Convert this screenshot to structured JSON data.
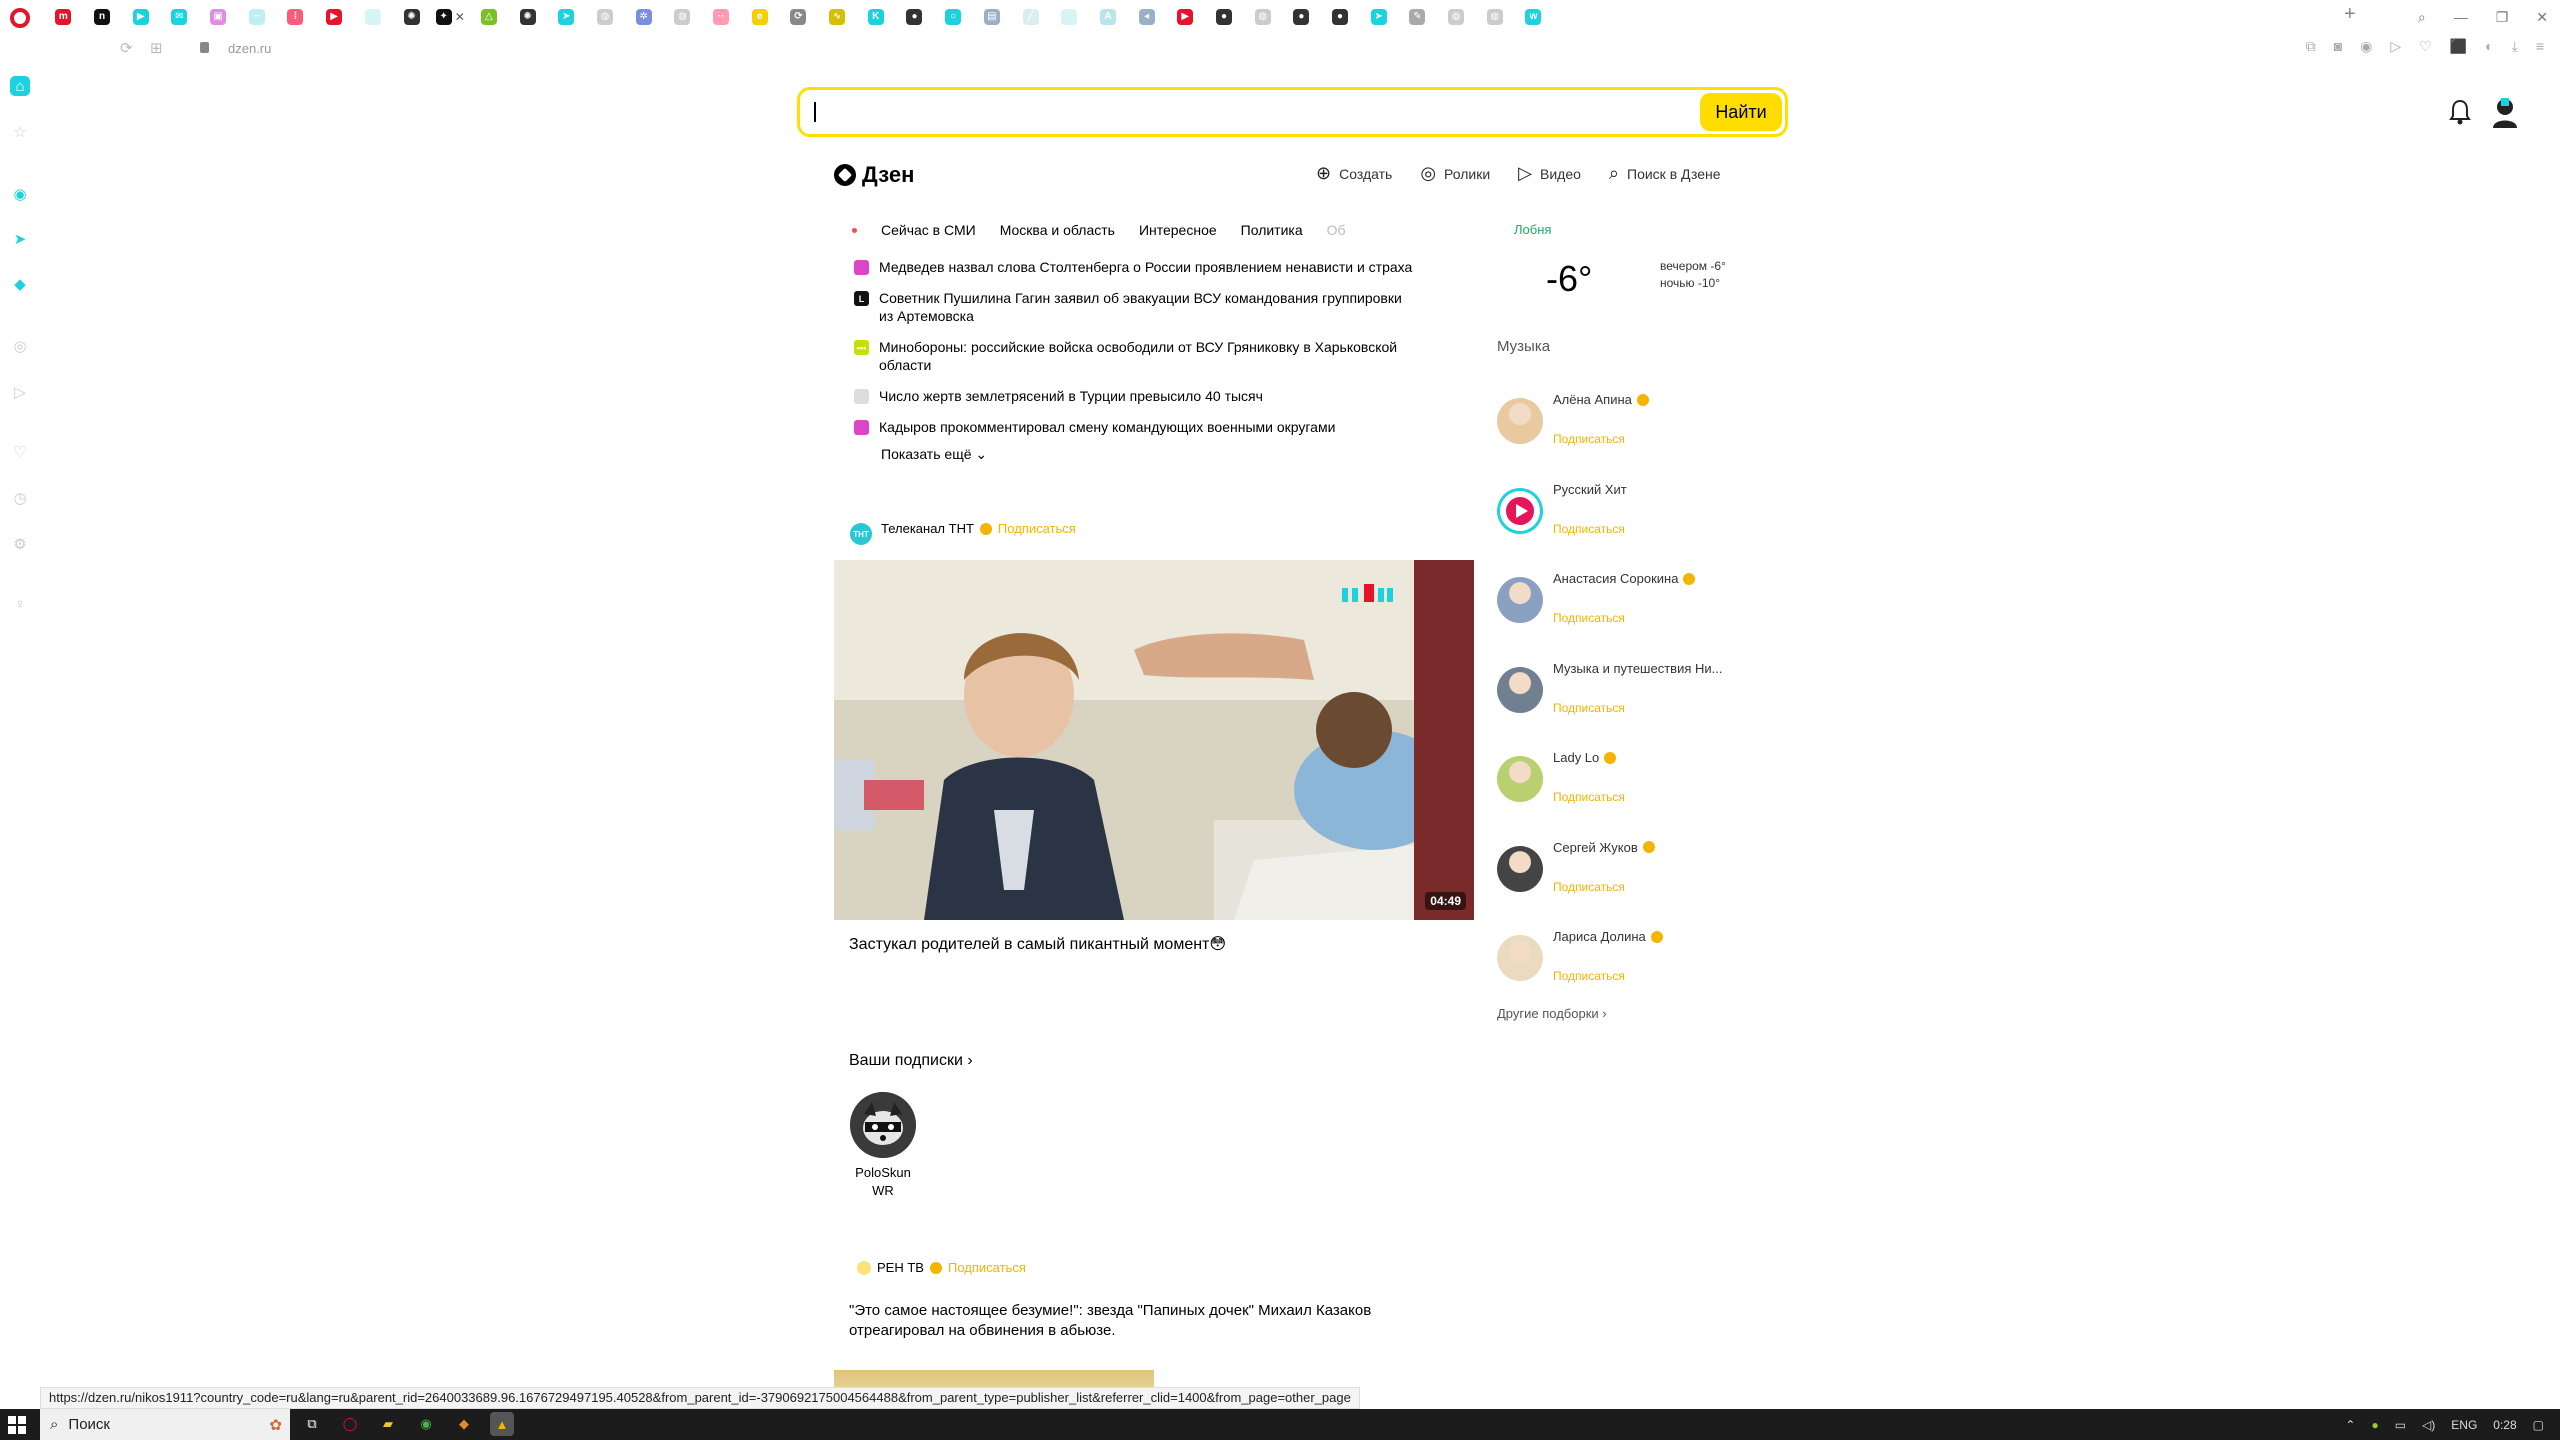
{
  "browser": {
    "url": "dzen.ru",
    "tabs": [
      {
        "icon": "gmail-icon",
        "color": "#e5142b",
        "glyph": "m"
      },
      {
        "icon": "notion-icon",
        "color": "#111111",
        "glyph": "n"
      },
      {
        "icon": "tab-audio-icon",
        "color": "#1dd2dc",
        "glyph": "▶"
      },
      {
        "icon": "mail-icon",
        "color": "#1dd2dc",
        "glyph": "✉"
      },
      {
        "icon": "app-icon",
        "color": "#e08de0",
        "glyph": "▣"
      },
      {
        "icon": "wave-icon",
        "color": "#bfeff3",
        "glyph": "~"
      },
      {
        "icon": "dots-icon",
        "color": "#ff5a7a",
        "glyph": "⁞"
      },
      {
        "icon": "youtube-icon",
        "color": "#e5142b",
        "glyph": "▶"
      },
      {
        "icon": "blank-page-icon",
        "color": "#d7f4f6",
        "glyph": ""
      },
      {
        "icon": "chatgpt-icon",
        "color": "#333333",
        "glyph": "✺"
      },
      {
        "icon": "dzen-icon",
        "color": "#111111",
        "glyph": "✦"
      },
      {
        "icon": "drive-icon",
        "color": "#7bbf2a",
        "glyph": "△"
      },
      {
        "icon": "chatgpt-icon",
        "color": "#333333",
        "glyph": "✺"
      },
      {
        "icon": "telegram-icon",
        "color": "#1dd2dc",
        "glyph": "➤"
      },
      {
        "icon": "globe-icon",
        "color": "#cccccc",
        "glyph": "◍"
      },
      {
        "icon": "puzzle-icon",
        "color": "#7a8fe0",
        "glyph": "✲"
      },
      {
        "icon": "globe-icon",
        "color": "#cccccc",
        "glyph": "◍"
      },
      {
        "icon": "dots-icon",
        "color": "#ff9ab0",
        "glyph": "··"
      },
      {
        "icon": "e-icon",
        "color": "#f5d000",
        "glyph": "e"
      },
      {
        "icon": "sync-icon",
        "color": "#888888",
        "glyph": "⟳"
      },
      {
        "icon": "chart-icon",
        "color": "#d4c000",
        "glyph": "∿"
      },
      {
        "icon": "kinopoisk-icon",
        "color": "#1dd2dc",
        "glyph": "K"
      },
      {
        "icon": "github-icon",
        "color": "#333333",
        "glyph": "●"
      },
      {
        "icon": "circle-icon",
        "color": "#1dd2dc",
        "glyph": "○"
      },
      {
        "icon": "image-icon",
        "color": "#9ab0c8",
        "glyph": "▤"
      },
      {
        "icon": "feather-icon",
        "color": "#d8eef0",
        "glyph": "╱"
      },
      {
        "icon": "page-icon",
        "color": "#d7f4f6",
        "glyph": ""
      },
      {
        "icon": "ai-icon",
        "color": "#b8e4ea",
        "glyph": "A"
      },
      {
        "icon": "arrow-icon",
        "color": "#9ab0c8",
        "glyph": "◂"
      },
      {
        "icon": "youtube-icon",
        "color": "#e5142b",
        "glyph": "▶"
      },
      {
        "icon": "github-icon",
        "color": "#333333",
        "glyph": "●"
      },
      {
        "icon": "globe-icon",
        "color": "#cccccc",
        "glyph": "◍"
      },
      {
        "icon": "github-icon",
        "color": "#333333",
        "glyph": "●"
      },
      {
        "icon": "github-icon",
        "color": "#333333",
        "glyph": "●"
      },
      {
        "icon": "telegram-icon",
        "color": "#1dd2dc",
        "glyph": "➤"
      },
      {
        "icon": "pen-icon",
        "color": "#aaaaaa",
        "glyph": "✎"
      },
      {
        "icon": "globe-icon",
        "color": "#cccccc",
        "glyph": "◍"
      },
      {
        "icon": "globe-icon",
        "color": "#cccccc",
        "glyph": "◍"
      },
      {
        "icon": "w-icon",
        "color": "#1dd2dc",
        "glyph": "w"
      }
    ]
  },
  "search": {
    "placeholder": "",
    "button_label": "Найти"
  },
  "header": {
    "logo_text": "Дзен",
    "nav": [
      {
        "icon": "create-icon",
        "glyph": "⊕",
        "label": "Создать"
      },
      {
        "icon": "shorts-icon",
        "glyph": "◎",
        "label": "Ролики"
      },
      {
        "icon": "video-play-icon",
        "glyph": "▷",
        "label": "Видео"
      },
      {
        "icon": "search-icon",
        "glyph": "⌕",
        "label": "Поиск в Дзене"
      }
    ]
  },
  "news": {
    "tabs": [
      "Сейчас в СМИ",
      "Москва и область",
      "Интересное",
      "Политика",
      "Об"
    ],
    "items": [
      {
        "icon_color": "#d946c8",
        "icon_glyph": "",
        "text": "Медведев назвал слова Столтенберга о России проявлением ненависти и страха"
      },
      {
        "icon_color": "#111111",
        "icon_glyph": "L",
        "text": "Советник Пушилина Гагин заявил об эвакуации ВСУ командования группировки из Артемовска"
      },
      {
        "icon_color": "#c8e000",
        "icon_glyph": "•••",
        "text": "Минобороны: российские войска освободили от ВСУ Гряниковку в Харьковской области"
      },
      {
        "icon_color": "#dddddd",
        "icon_glyph": "",
        "text": "Число жертв землетрясений в Турции превысило 40 тысяч"
      },
      {
        "icon_color": "#d946c8",
        "icon_glyph": "",
        "text": "Кадыров прокомментировал смену командующих военными округами"
      }
    ],
    "show_more": "Показать ещё"
  },
  "post1": {
    "channel": "Телеканал ТНТ",
    "avatar_text": "ТНТ",
    "subscribe": "Подписаться",
    "duration": "04:49",
    "title": "Застукал родителей в самый пикантный момент😳"
  },
  "subscriptions": {
    "header": "Ваши подписки",
    "items": [
      {
        "name": "PoloSkun WR"
      }
    ]
  },
  "post2": {
    "channel": "РЕН ТВ",
    "subscribe": "Подписаться",
    "title": "\"Это самое настоящее безумие!\": звезда \"Папиных дочек\" Михаил Казаков отреагировал на обвинения в абьюзе."
  },
  "weather": {
    "city": "Лобня",
    "temp": "-6°",
    "evening": "вечером -6°",
    "night": "ночью -10°"
  },
  "music": {
    "title": "Музыка",
    "artists": [
      {
        "name": "Алёна Апина",
        "verified": true,
        "avatar": "#e8c9a0"
      },
      {
        "name": "Русский Хит",
        "verified": false,
        "avatar": "#1dd2dc"
      },
      {
        "name": "Анастасия Сорокина",
        "verified": true,
        "avatar": "#8aa0c0"
      },
      {
        "name": "Музыка и путешествия Ни...",
        "verified": false,
        "avatar": "#708090"
      },
      {
        "name": "Lady Lo",
        "verified": true,
        "avatar": "#b8d070"
      },
      {
        "name": "Сергей Жуков",
        "verified": true,
        "avatar": "#444444"
      },
      {
        "name": "Лариса Долина",
        "verified": true,
        "avatar": "#eadbc0"
      }
    ],
    "subscribe": "Подписаться",
    "other_subs": "Другие подборки"
  },
  "status_url": "https://dzen.ru/nikos1911?country_code=ru&lang=ru&parent_rid=2640033689.96.1676729497195.40528&from_parent_id=-3790692175004564488&from_parent_type=publisher_list&referrer_clid=1400&from_page=other_page",
  "taskbar": {
    "search_label": "Поиск",
    "lang": "ENG",
    "time": "0:28"
  }
}
